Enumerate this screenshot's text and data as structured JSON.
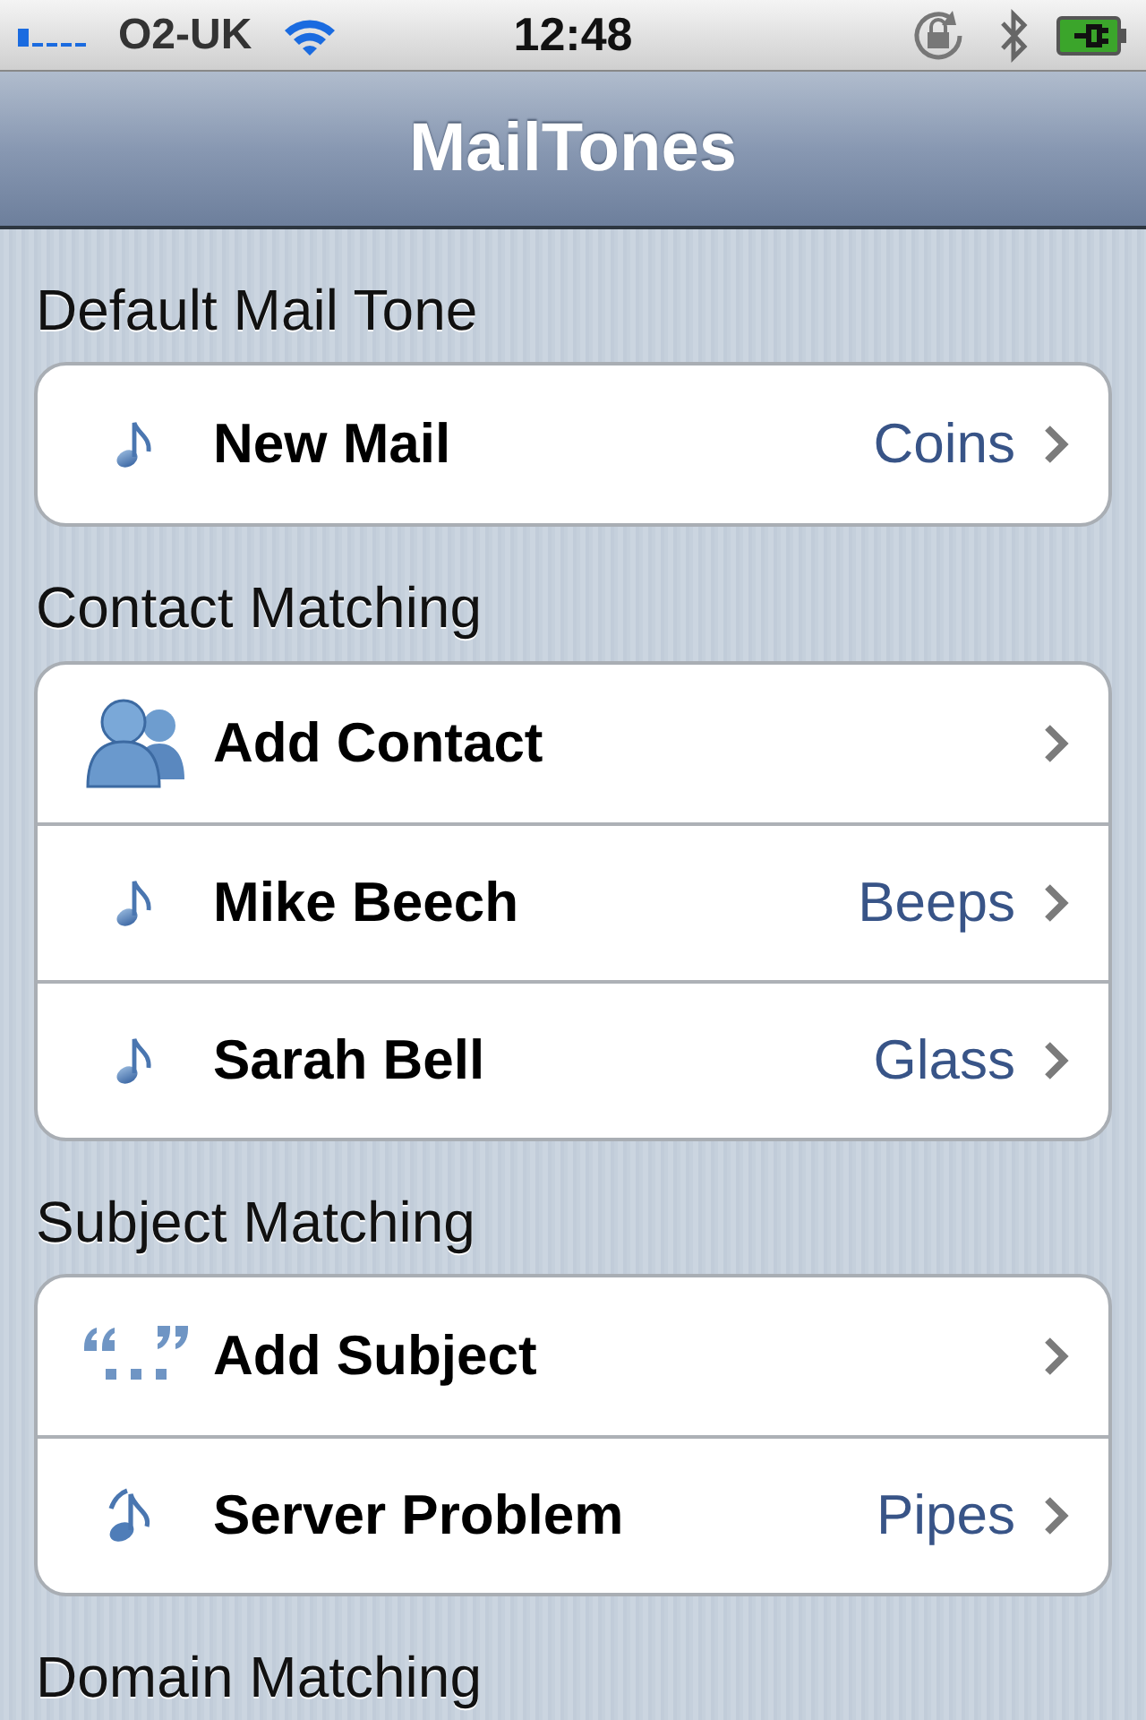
{
  "status_bar": {
    "carrier": "O2-UK",
    "time": "12:48"
  },
  "nav_bar": {
    "title": "MailTones"
  },
  "sections": [
    {
      "header": "Default Mail Tone",
      "rows": [
        {
          "kind": "note",
          "label": "New Mail",
          "detail": "Coins"
        }
      ]
    },
    {
      "header": "Contact Matching",
      "rows": [
        {
          "kind": "people",
          "label": "Add Contact"
        },
        {
          "kind": "note",
          "label": "Mike Beech",
          "detail": "Beeps"
        },
        {
          "kind": "note",
          "label": "Sarah Bell",
          "detail": "Glass"
        }
      ]
    },
    {
      "header": "Subject Matching",
      "rows": [
        {
          "kind": "quotes",
          "label": "Add Subject"
        },
        {
          "kind": "double-note",
          "label": "Server Problem",
          "detail": "Pipes"
        }
      ]
    },
    {
      "header": "Domain Matching"
    }
  ]
}
